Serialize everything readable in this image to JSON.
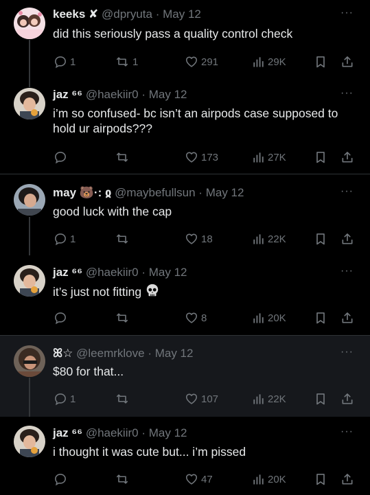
{
  "colors": {
    "bg": "#000000",
    "text": "#e7e9ea",
    "muted": "#71767b",
    "divider": "#2f3336",
    "highlight_bg": "#16181c"
  },
  "tweets": [
    {
      "name": "keeks",
      "name_suffix": "✘",
      "handle": "@dpryuta",
      "dot": "·",
      "date": "May 12",
      "text": "did this seriously pass a quality control check",
      "reply": "1",
      "retweet": "1",
      "like": "291",
      "views": "29K"
    },
    {
      "name": "jaz",
      "name_suffix": "⁶⁶",
      "handle": "@haekiir0",
      "dot": "·",
      "date": "May 12",
      "text": "i’m so confused- bc isn’t an airpods case supposed to hold ur airpods???",
      "reply": "",
      "retweet": "",
      "like": "173",
      "views": "27K"
    },
    {
      "name": "may",
      "name_suffix": "🐻·: ჲ",
      "handle": "@maybefullsun",
      "dot": "·",
      "date": "May 12",
      "text": "good luck with the cap",
      "reply": "1",
      "retweet": "",
      "like": "18",
      "views": "22K"
    },
    {
      "name": "jaz",
      "name_suffix": "⁶⁶",
      "handle": "@haekiir0",
      "dot": "·",
      "date": "May 12",
      "text": "it’s just not fitting",
      "reply": "",
      "retweet": "",
      "like": "8",
      "views": "20K"
    },
    {
      "name": "ꕤ☆",
      "name_suffix": "",
      "handle": "@leemrklove",
      "dot": "·",
      "date": "May 12",
      "text": "$80 for that...",
      "reply": "1",
      "retweet": "",
      "like": "107",
      "views": "22K"
    },
    {
      "name": "jaz",
      "name_suffix": "⁶⁶",
      "handle": "@haekiir0",
      "dot": "·",
      "date": "May 12",
      "text": "i thought it was cute but... i’m pissed",
      "reply": "",
      "retweet": "",
      "like": "47",
      "views": "20K"
    }
  ],
  "more_glyph": "···"
}
